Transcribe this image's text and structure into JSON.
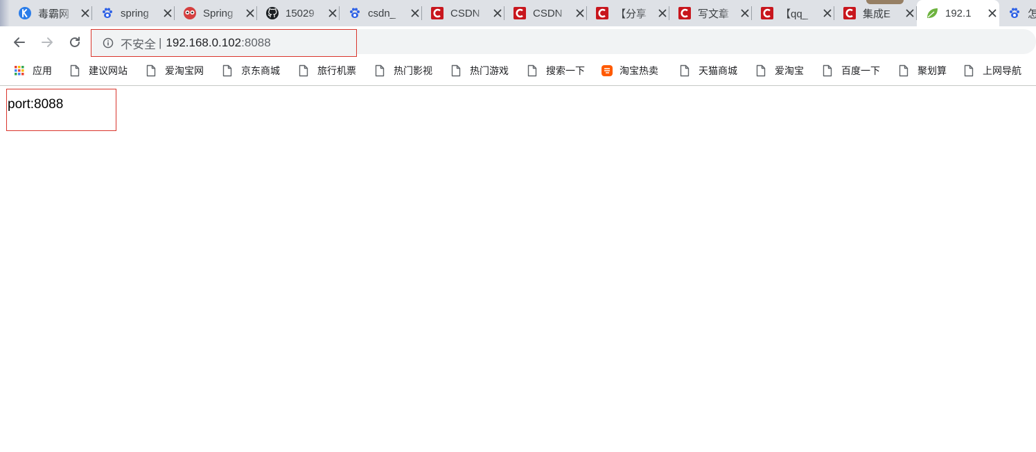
{
  "browser": {
    "tabs": [
      {
        "label": "毒霸网",
        "icon": "k-logo-icon",
        "color": "#2b7de9"
      },
      {
        "label": "spring",
        "icon": "baidu-paw-icon",
        "color": "#2f62e6"
      },
      {
        "label": "Spring",
        "icon": "owl-logo-icon",
        "color": "#d53f3f"
      },
      {
        "label": "15029",
        "icon": "github-icon",
        "color": "#1b1f23"
      },
      {
        "label": "csdn_",
        "icon": "baidu-paw-icon",
        "color": "#2f62e6"
      },
      {
        "label": "CSDN",
        "icon": "csdn-icon",
        "color": "#c8161d"
      },
      {
        "label": "CSDN",
        "icon": "csdn-icon",
        "color": "#c8161d"
      },
      {
        "label": "【分享",
        "icon": "csdn-icon",
        "color": "#c8161d"
      },
      {
        "label": "写文章",
        "icon": "csdn-icon",
        "color": "#c8161d"
      },
      {
        "label": "【qq_",
        "icon": "csdn-icon",
        "color": "#c8161d"
      },
      {
        "label": "集成E",
        "icon": "csdn-icon",
        "color": "#c8161d"
      },
      {
        "label": "192.1",
        "icon": "spring-leaf-icon",
        "color": "#6db33f",
        "active": true
      },
      {
        "label": "怎",
        "icon": "baidu-paw-icon",
        "color": "#2f62e6"
      }
    ],
    "omnibox": {
      "security_label": "不安全",
      "divider": "|",
      "url_host": "192.168.0.102",
      "url_port": ":8088"
    },
    "bookmarks": [
      {
        "label": "应用",
        "icon": "apps-grid-icon"
      },
      {
        "label": "建议网站",
        "icon": "page-icon"
      },
      {
        "label": "爱淘宝网",
        "icon": "page-icon"
      },
      {
        "label": "京东商城",
        "icon": "page-icon"
      },
      {
        "label": "旅行机票",
        "icon": "page-icon"
      },
      {
        "label": "热门影视",
        "icon": "page-icon"
      },
      {
        "label": "热门游戏",
        "icon": "page-icon"
      },
      {
        "label": "搜索一下",
        "icon": "page-icon"
      },
      {
        "label": "淘宝热卖",
        "icon": "taobao-icon"
      },
      {
        "label": "天猫商城",
        "icon": "page-icon"
      },
      {
        "label": "爱淘宝",
        "icon": "page-icon"
      },
      {
        "label": "百度一下",
        "icon": "page-icon"
      },
      {
        "label": "聚划算",
        "icon": "page-icon"
      },
      {
        "label": "上网导航",
        "icon": "page-icon"
      }
    ]
  },
  "page": {
    "port_text": "port:8088"
  },
  "colors": {
    "highlight_border": "#d9342b",
    "tabstrip_bg": "#dee1e6",
    "omnibox_bg": "#f1f3f4"
  }
}
